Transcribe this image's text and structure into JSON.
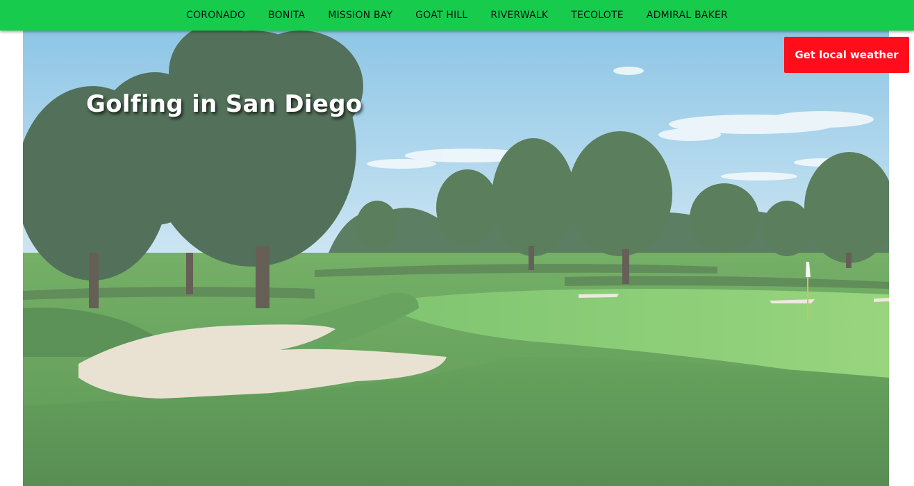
{
  "nav": {
    "items": [
      {
        "label": "CORONADO"
      },
      {
        "label": "BONITA"
      },
      {
        "label": "MISSION BAY"
      },
      {
        "label": "GOAT HILL"
      },
      {
        "label": "RIVERWALK"
      },
      {
        "label": "TECOLOTE"
      },
      {
        "label": "ADMIRAL BAKER"
      }
    ]
  },
  "hero": {
    "title": "Golfing in San Diego",
    "image": "golf-course-photo"
  },
  "weather_button": {
    "label": "Get local weather"
  },
  "colors": {
    "nav_bg": "#17cc4c",
    "button_bg": "#ff0d1a"
  }
}
